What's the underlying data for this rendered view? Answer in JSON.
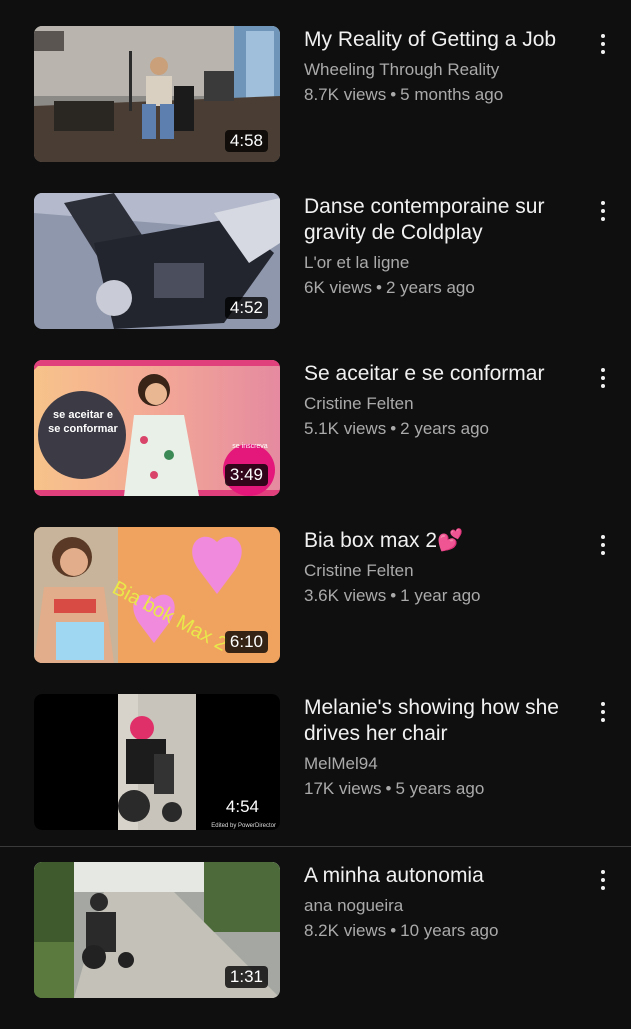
{
  "videos": [
    {
      "title": "My Reality of Getting a Job",
      "title_emoji": "",
      "channel": "Wheeling Through Reality",
      "views": "8.7K views",
      "age": "5 months ago",
      "duration": "4:58"
    },
    {
      "title": "Danse contemporaine sur gravity de Coldplay",
      "title_emoji": "",
      "channel": "L'or et la ligne",
      "views": "6K views",
      "age": "2 years ago",
      "duration": "4:52"
    },
    {
      "title": "Se aceitar e se conformar",
      "title_emoji": "",
      "channel": "Cristine Felten",
      "views": "5.1K views",
      "age": "2 years ago",
      "duration": "3:49",
      "thumb_text": "se aceitar e se conformar",
      "thumb_badge": "se inscreva"
    },
    {
      "title": "Bia box max 2",
      "title_emoji": "💕",
      "channel": "Cristine Felten",
      "views": "3.6K views",
      "age": "1 year ago",
      "duration": "6:10",
      "thumb_text": "Bia bok Max 2"
    },
    {
      "title": "Melanie's showing how she drives her chair",
      "title_emoji": "",
      "channel": "MelMel94",
      "views": "17K views",
      "age": "5 years ago",
      "duration": "4:54",
      "thumb_text": "Edited by PowerDirector"
    },
    {
      "title": "A minha autonomia",
      "title_emoji": "",
      "channel": "ana nogueira",
      "views": "8.2K views",
      "age": "10 years ago",
      "duration": "1:31"
    }
  ],
  "separator": "•",
  "colors": {
    "background": "#0f0f0f",
    "text": "#f1f1f1",
    "secondary": "#aaaaaa"
  }
}
